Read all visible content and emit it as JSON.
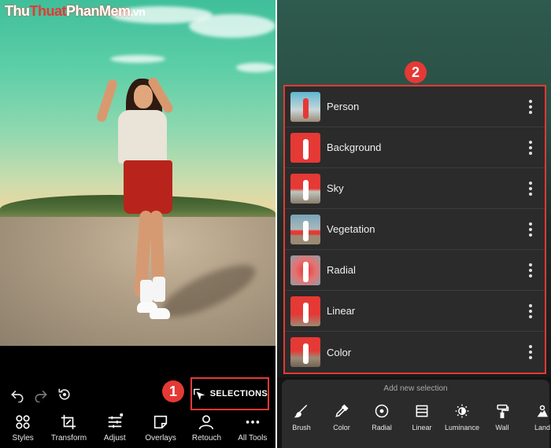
{
  "watermark": {
    "part1": "Thu",
    "part2": "Thuat",
    "part3": "PhanMem",
    "part4": ".vn"
  },
  "left": {
    "history": {
      "undo_icon": "undo-icon",
      "redo_icon": "redo-icon",
      "reset_icon": "reset-icon"
    },
    "step_badge": "1",
    "selections_button": {
      "label": "SELECTIONS",
      "icon": "selection-icon"
    },
    "tools": [
      {
        "label": "Styles",
        "icon": "styles-icon"
      },
      {
        "label": "Transform",
        "icon": "crop-icon"
      },
      {
        "label": "Adjust",
        "icon": "sliders-icon"
      },
      {
        "label": "Overlays",
        "icon": "overlays-icon"
      },
      {
        "label": "Retouch",
        "icon": "person-icon"
      },
      {
        "label": "All Tools",
        "icon": "more-icon"
      }
    ]
  },
  "right": {
    "step_badge": "2",
    "selections": [
      {
        "label": "Person"
      },
      {
        "label": "Background"
      },
      {
        "label": "Sky"
      },
      {
        "label": "Vegetation"
      },
      {
        "label": "Radial"
      },
      {
        "label": "Linear"
      },
      {
        "label": "Color"
      }
    ],
    "add_panel": {
      "title": "Add new selection",
      "tools": [
        {
          "label": "Brush",
          "icon": "brush-icon"
        },
        {
          "label": "Color",
          "icon": "eyedropper-icon"
        },
        {
          "label": "Radial",
          "icon": "radial-icon"
        },
        {
          "label": "Linear",
          "icon": "linear-icon"
        },
        {
          "label": "Luminance",
          "icon": "luminance-icon"
        },
        {
          "label": "Wall",
          "icon": "paint-roller-icon"
        },
        {
          "label": "Land",
          "icon": "land-icon"
        }
      ]
    }
  },
  "colors": {
    "accent": "#e53935",
    "panel": "#2b2b2b",
    "background": "#000000"
  }
}
